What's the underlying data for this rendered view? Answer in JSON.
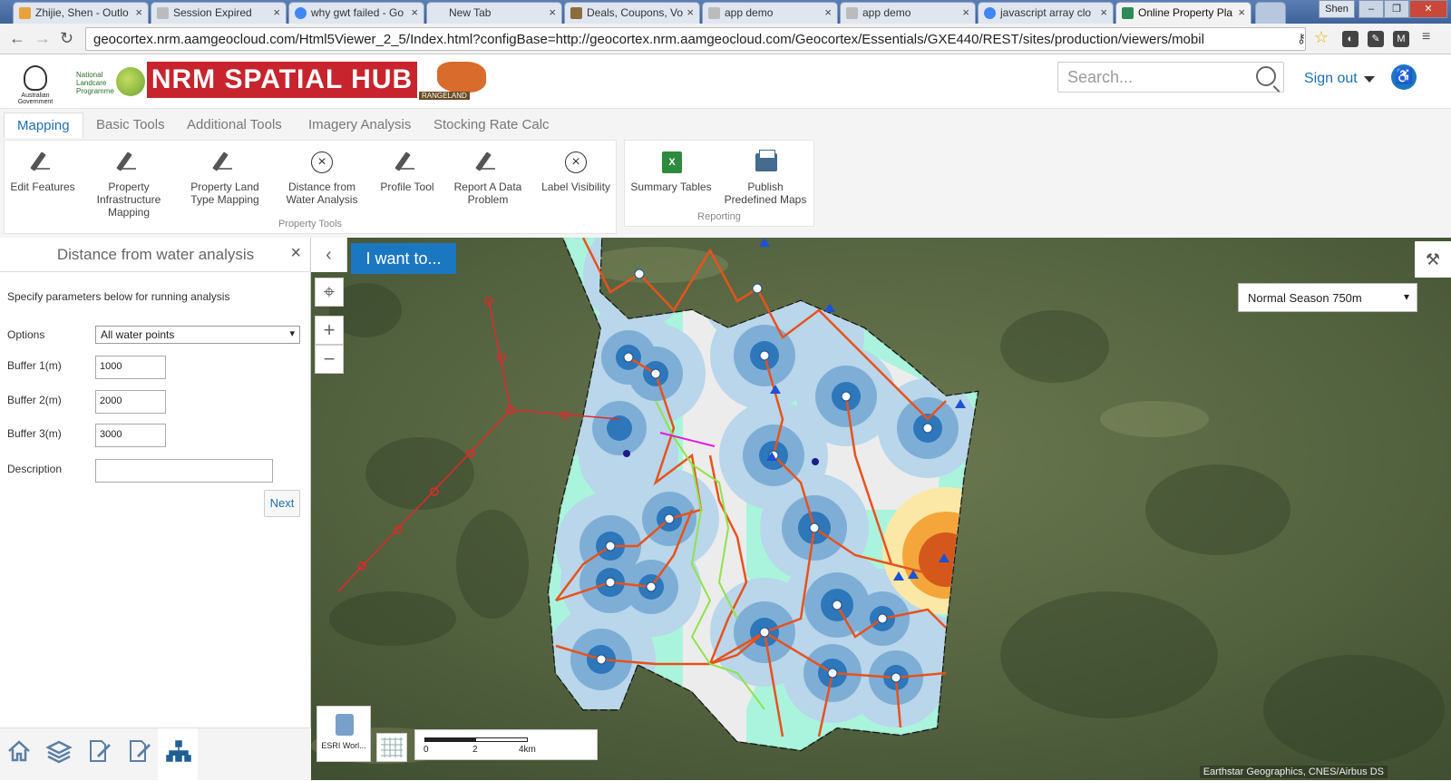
{
  "browser": {
    "tabs": [
      {
        "label": "Zhijie, Shen - Outlo"
      },
      {
        "label": "Session Expired"
      },
      {
        "label": "why gwt failed - Go"
      },
      {
        "label": "New Tab"
      },
      {
        "label": "Deals, Coupons, Vo"
      },
      {
        "label": "app demo"
      },
      {
        "label": "app demo"
      },
      {
        "label": "javascript array clo"
      },
      {
        "label": "Online Property Pla"
      }
    ],
    "user": "Shen",
    "url": "geocortex.nrm.aamgeocloud.com/Html5Viewer_2_5/Index.html?configBase=http://geocortex.nrm.aamgeocloud.com/Geocortex/Essentials/GXE440/REST/sites/production/viewers/mobil"
  },
  "header": {
    "gov_label": "Australian Government",
    "nlp_label": [
      "National",
      "Landcare",
      "Programme"
    ],
    "title": "NRM SPATIAL HUB",
    "rangeland_label": "RANGELAND",
    "search_placeholder": "Search...",
    "signout": "Sign out"
  },
  "ribbon": {
    "tabs": [
      "Mapping",
      "Basic Tools",
      "Additional Tools",
      "Imagery Analysis",
      "Stocking Rate Calc"
    ],
    "property_tools": {
      "label": "Property Tools",
      "items": [
        {
          "label": "Edit Features",
          "icon": "pencil-ruler-icon"
        },
        {
          "label": "Property Infrastructure Mapping",
          "icon": "pencil-ruler-icon"
        },
        {
          "label": "Property Land Type Mapping",
          "icon": "pencil-ruler-icon"
        },
        {
          "label": "Distance from Water Analysis",
          "icon": "circle-x-icon"
        },
        {
          "label": "Profile Tool",
          "icon": "pencil-ruler-icon"
        },
        {
          "label": "Report A Data Problem",
          "icon": "pencil-ruler-icon"
        },
        {
          "label": "Label Visibility",
          "icon": "circle-x-icon"
        }
      ]
    },
    "reporting": {
      "label": "Reporting",
      "items": [
        {
          "label": "Summary Tables",
          "icon": "spreadsheet-icon"
        },
        {
          "label": "Publish Predefined Maps",
          "icon": "printer-icon"
        }
      ]
    }
  },
  "panel": {
    "title": "Distance from water analysis",
    "intro": "Specify parameters below for running analysis",
    "options_label": "Options",
    "options_value": "All water points",
    "buffer1_label": "Buffer 1(m)",
    "buffer1_value": "1000",
    "buffer2_label": "Buffer 2(m)",
    "buffer2_value": "2000",
    "buffer3_label": "Buffer 3(m)",
    "buffer3_value": "3000",
    "description_label": "Description",
    "description_value": "",
    "next": "Next"
  },
  "map": {
    "i_want_to": "I want to...",
    "season": "Normal Season 750m",
    "basemap_label": "ESRI Worl...",
    "scale_ticks": [
      "0",
      "2",
      "4km"
    ],
    "attribution": "Earthstar Geographics, CNES/Airbus DS",
    "colors": {
      "buffer_inner": "#2d77ba",
      "buffer_mid": "#7eaed6",
      "buffer_outer": "#b9d6ea",
      "far_zone": "#9ff5d9",
      "property": "#ececec",
      "fence": "#e8521b",
      "creek": "#8fe34a"
    }
  }
}
